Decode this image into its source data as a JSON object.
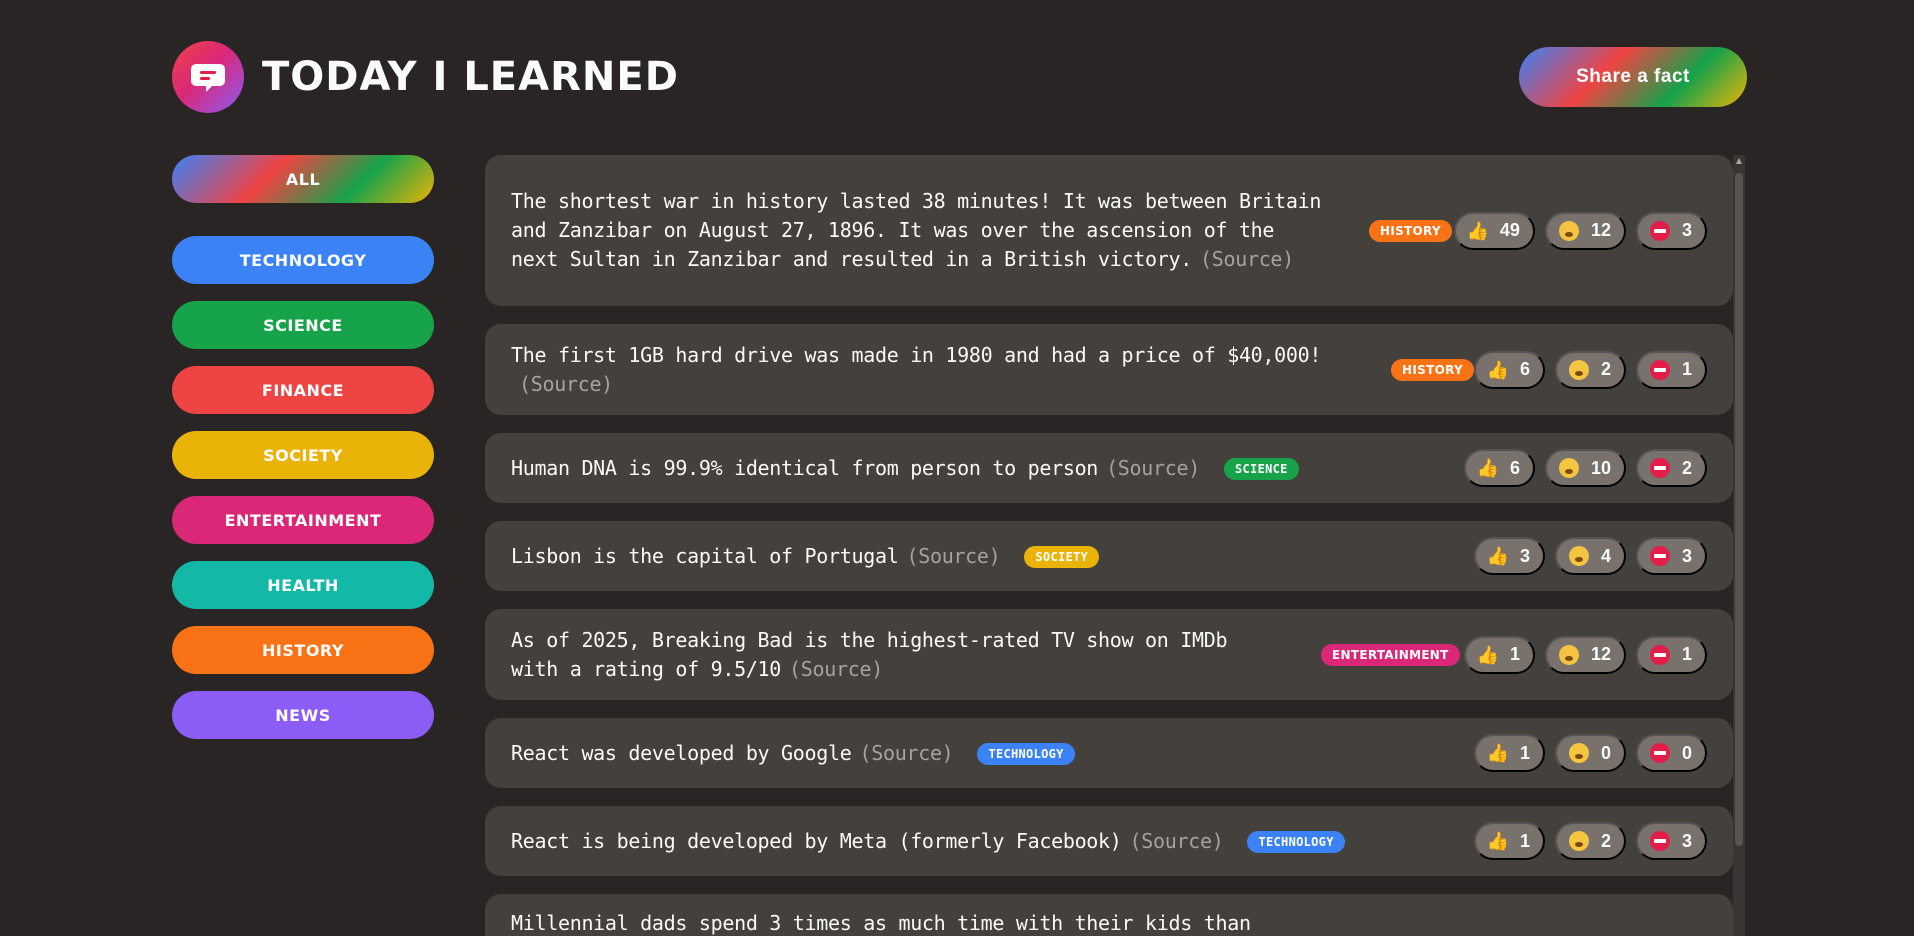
{
  "header": {
    "title": "Today I Learned",
    "share_label": "Share a fact"
  },
  "colors": {
    "background": "#292524",
    "card": "#44403c",
    "vote_button": "#78716c",
    "technology": "#3b82f6",
    "science": "#16a34a",
    "finance": "#ef4444",
    "society": "#eab308",
    "entertainment": "#db2777",
    "health": "#14b8a6",
    "history": "#f97316",
    "news": "#8b5cf6"
  },
  "sidebar": {
    "all_label": "All",
    "categories": [
      {
        "label": "Technology",
        "color": "#3b82f6"
      },
      {
        "label": "Science",
        "color": "#16a34a"
      },
      {
        "label": "Finance",
        "color": "#ef4444"
      },
      {
        "label": "Society",
        "color": "#eab308"
      },
      {
        "label": "Entertainment",
        "color": "#db2777"
      },
      {
        "label": "Health",
        "color": "#14b8a6"
      },
      {
        "label": "History",
        "color": "#f97316"
      },
      {
        "label": "News",
        "color": "#8b5cf6"
      }
    ]
  },
  "source_label": "(Source)",
  "facts": [
    {
      "text": "The shortest war in history lasted 38 minutes! It was between Britain and Zanzibar on August 27, 1896. It was over the ascension of the next Sultan in Zanzibar and resulted in a British victory.",
      "category": "History",
      "color": "#f97316",
      "likes": "49",
      "mindblowing": "12",
      "false": "3"
    },
    {
      "text": "The first 1GB hard drive was made in 1980 and had a price of $40,000!",
      "category": "History",
      "color": "#f97316",
      "likes": "6",
      "mindblowing": "2",
      "false": "1"
    },
    {
      "text": "Human DNA is 99.9% identical from person to person",
      "category": "Science",
      "color": "#16a34a",
      "likes": "6",
      "mindblowing": "10",
      "false": "2"
    },
    {
      "text": "Lisbon is the capital of Portugal",
      "category": "Society",
      "color": "#eab308",
      "likes": "3",
      "mindblowing": "4",
      "false": "3"
    },
    {
      "text": "As of 2025, Breaking Bad is the highest-rated TV show on IMDb with a rating of 9.5/10",
      "category": "Entertainment",
      "color": "#db2777",
      "likes": "1",
      "mindblowing": "12",
      "false": "1"
    },
    {
      "text": "React was developed by Google",
      "category": "Technology",
      "color": "#3b82f6",
      "likes": "1",
      "mindblowing": "0",
      "false": "0"
    },
    {
      "text": "React is being developed by Meta (formerly Facebook)",
      "category": "Technology",
      "color": "#3b82f6",
      "likes": "1",
      "mindblowing": "2",
      "false": "3"
    },
    {
      "text": "Millennial dads spend 3 times as much time with their kids than"
    }
  ]
}
